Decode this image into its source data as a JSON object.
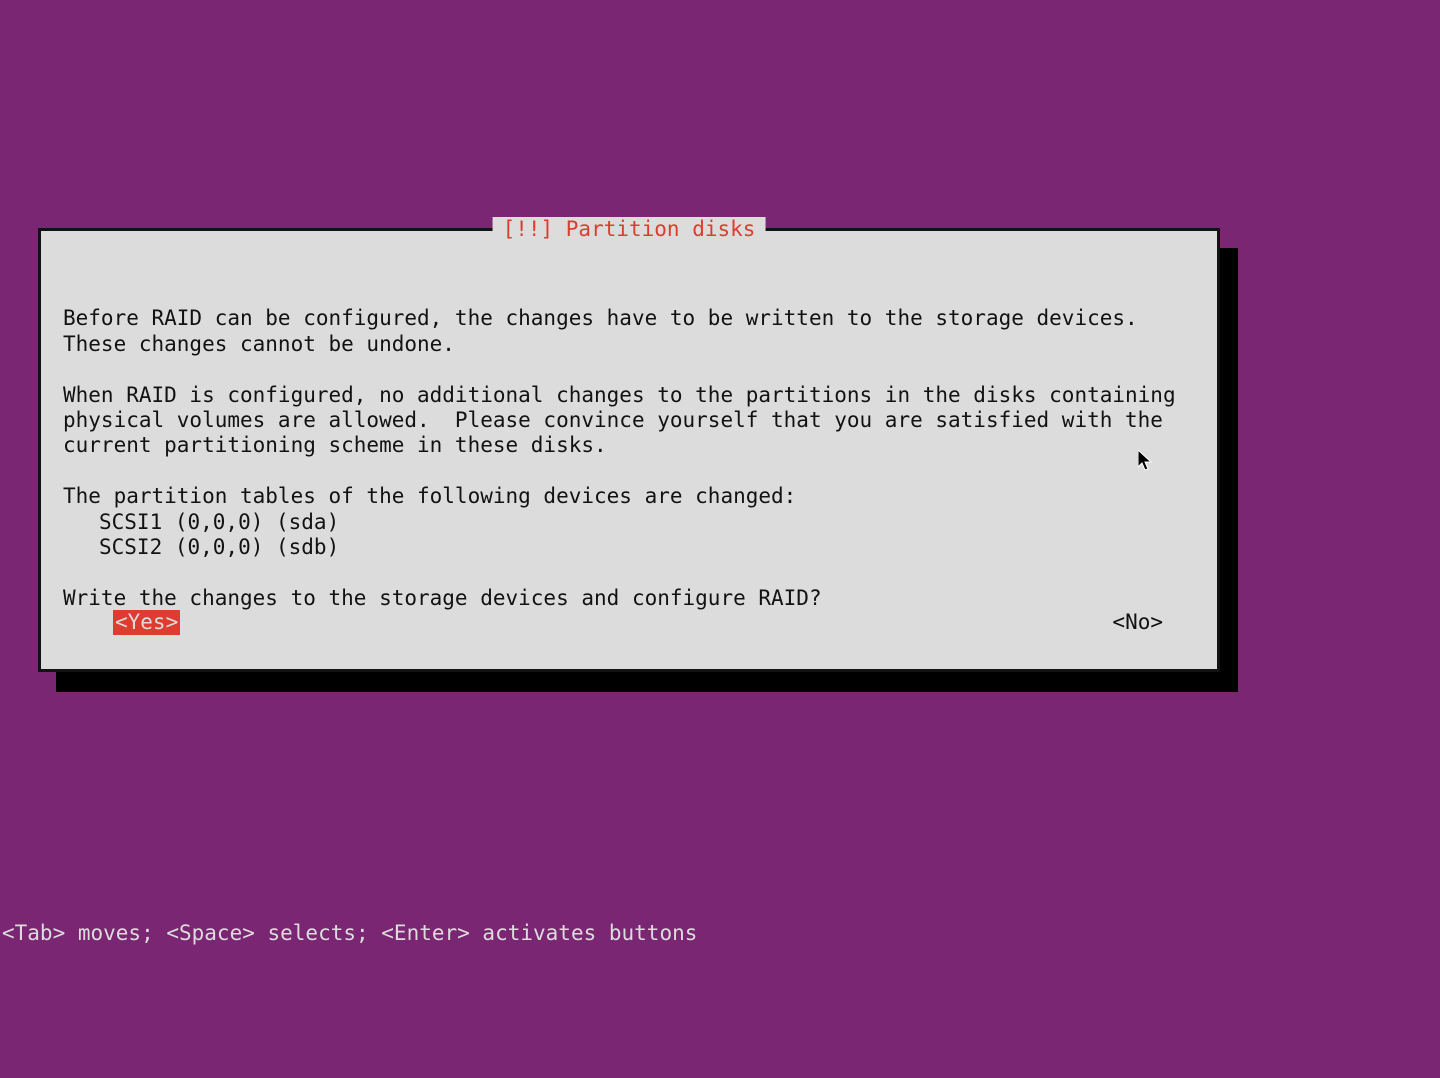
{
  "dialog": {
    "bang": "[!!] ",
    "title": "Partition disks",
    "para1": "Before RAID can be configured, the changes have to be written to the storage devices. These changes cannot be undone.",
    "para2": "When RAID is configured, no additional changes to the partitions in the disks containing physical volumes are allowed.  Please convince yourself that you are satisfied with the current partitioning scheme in these disks.",
    "changed_intro": "The partition tables of the following devices are changed:",
    "devices": [
      "SCSI1 (0,0,0) (sda)",
      "SCSI2 (0,0,0) (sdb)"
    ],
    "question": "Write the changes to the storage devices and configure RAID?",
    "yes_label": "<Yes>",
    "no_label": "<No>"
  },
  "hintbar": "<Tab> moves; <Space> selects; <Enter> activates buttons"
}
